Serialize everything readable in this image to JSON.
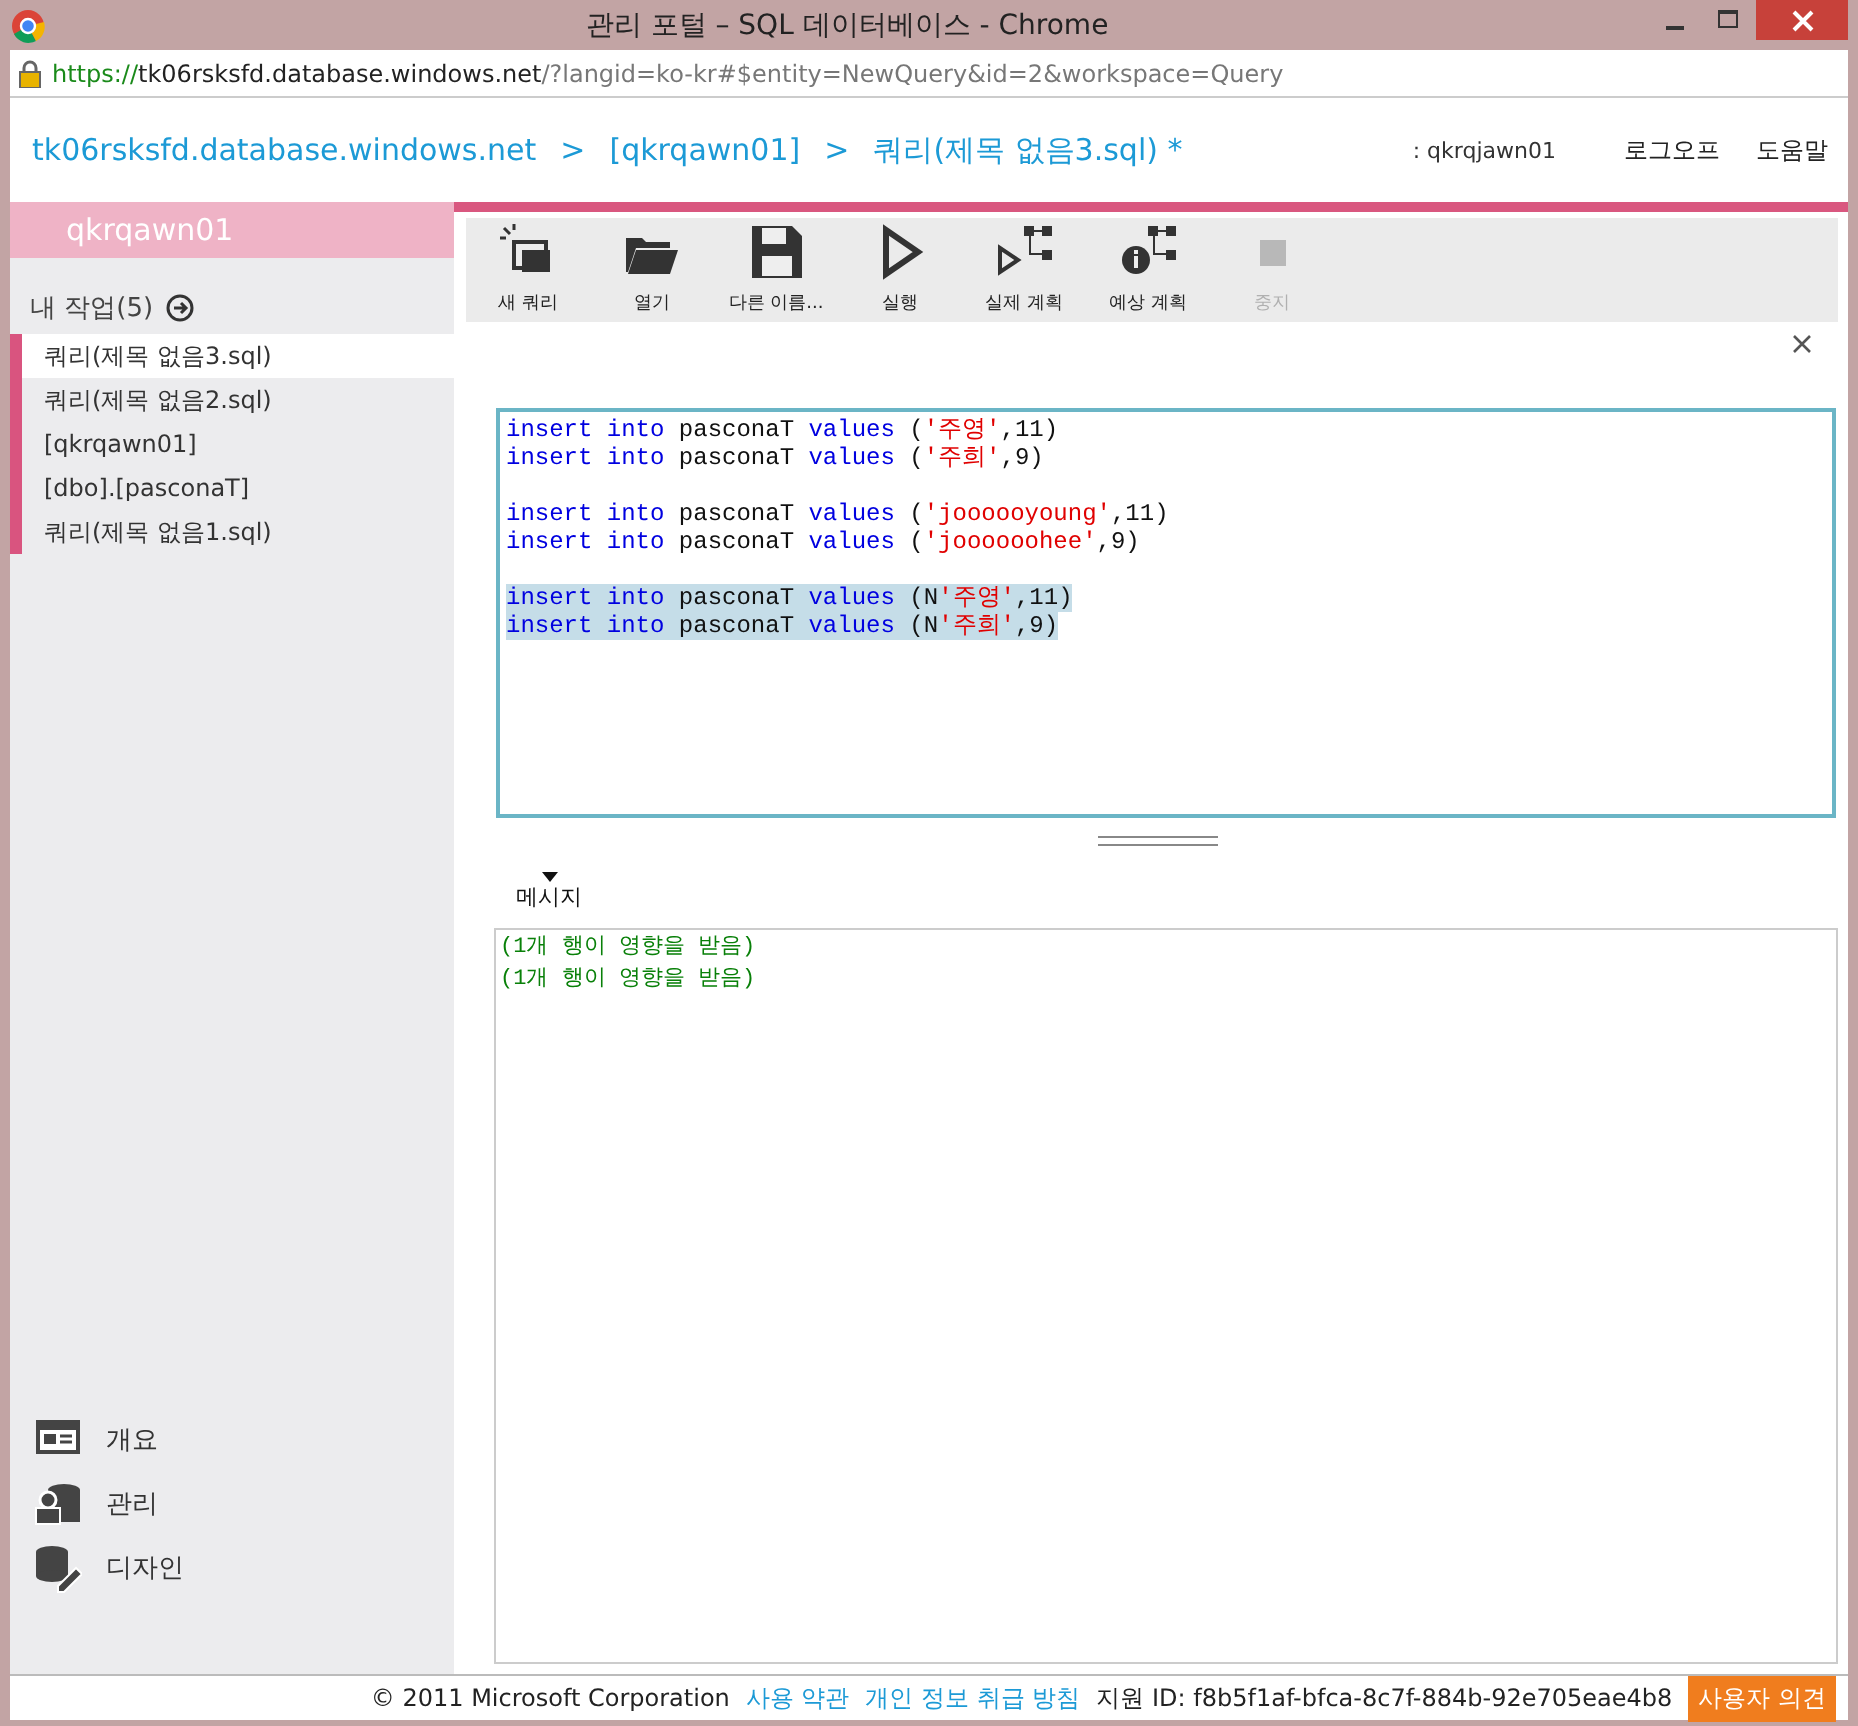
{
  "window": {
    "title": "관리 포털 – SQL 데이터베이스 - Chrome"
  },
  "address_bar": {
    "scheme": "https://",
    "host": "tk06rsksfd.database.windows.net",
    "path": "/?langid=ko-kr#$entity=NewQuery&id=2&workspace=Query"
  },
  "breadcrumb": [
    {
      "kind": "link",
      "text": "tk06rsksfd.database.windows.net"
    },
    {
      "kind": "separator",
      "text": ">"
    },
    {
      "kind": "link",
      "text": "[qkrqawn01]"
    },
    {
      "kind": "separator",
      "text": ">"
    },
    {
      "kind": "link",
      "text": "쿼리(제목 없음3.sql) *"
    }
  ],
  "user": {
    "label": ": qkrqjawn01"
  },
  "header_links": [
    {
      "label": "로그오프"
    },
    {
      "label": "도움말"
    }
  ],
  "sidebar": {
    "account": "qkrqawn01",
    "section": {
      "label": "내 작업(5)"
    },
    "items": [
      {
        "label": "쿼리(제목 없음3.sql)",
        "selected": true
      },
      {
        "label": "쿼리(제목 없음2.sql)",
        "selected": false
      },
      {
        "label": "[qkrqawn01]",
        "selected": false
      },
      {
        "label": "[dbo].[pasconaT]",
        "selected": false
      },
      {
        "label": "쿼리(제목 없음1.sql)",
        "selected": false
      }
    ],
    "nav": [
      {
        "kind": "overview",
        "label": "개요"
      },
      {
        "kind": "manage",
        "label": "관리"
      },
      {
        "kind": "design",
        "label": "디자인"
      }
    ]
  },
  "toolbar": {
    "buttons": [
      {
        "kind": "new",
        "label": "새 쿼리",
        "disabled": false
      },
      {
        "kind": "open",
        "label": "열기",
        "disabled": false
      },
      {
        "kind": "save",
        "label": "다른 이름...",
        "disabled": false
      },
      {
        "kind": "run",
        "label": "실행",
        "disabled": false
      },
      {
        "kind": "actual-plan",
        "label": "실제 계획",
        "disabled": false
      },
      {
        "kind": "estimated-plan",
        "label": "예상 계획",
        "disabled": false
      },
      {
        "kind": "stop",
        "label": "중지",
        "disabled": true
      }
    ]
  },
  "editor": {
    "lines": [
      {
        "kind": "code",
        "selected": false,
        "tokens": [
          {
            "kind": "keyword",
            "text": "insert into "
          },
          {
            "kind": "plain",
            "text": "pasconaT "
          },
          {
            "kind": "keyword",
            "text": "values "
          },
          {
            "kind": "plain",
            "text": "("
          },
          {
            "kind": "string",
            "text": "'주영'"
          },
          {
            "kind": "plain",
            "text": ",11)"
          }
        ]
      },
      {
        "kind": "code",
        "selected": false,
        "tokens": [
          {
            "kind": "keyword",
            "text": "insert into "
          },
          {
            "kind": "plain",
            "text": "pasconaT "
          },
          {
            "kind": "keyword",
            "text": "values "
          },
          {
            "kind": "plain",
            "text": "("
          },
          {
            "kind": "string",
            "text": "'주희'"
          },
          {
            "kind": "plain",
            "text": ",9)"
          }
        ]
      },
      {
        "kind": "blank"
      },
      {
        "kind": "code",
        "selected": false,
        "tokens": [
          {
            "kind": "keyword",
            "text": "insert into "
          },
          {
            "kind": "plain",
            "text": "pasconaT "
          },
          {
            "kind": "keyword",
            "text": "values "
          },
          {
            "kind": "plain",
            "text": "("
          },
          {
            "kind": "string",
            "text": "'joooooyoung'"
          },
          {
            "kind": "plain",
            "text": ",11)"
          }
        ]
      },
      {
        "kind": "code",
        "selected": false,
        "tokens": [
          {
            "kind": "keyword",
            "text": "insert into "
          },
          {
            "kind": "plain",
            "text": "pasconaT "
          },
          {
            "kind": "keyword",
            "text": "values "
          },
          {
            "kind": "plain",
            "text": "("
          },
          {
            "kind": "string",
            "text": "'joooooohee'"
          },
          {
            "kind": "plain",
            "text": ",9)"
          }
        ]
      },
      {
        "kind": "blank"
      },
      {
        "kind": "code",
        "selected": true,
        "tokens": [
          {
            "kind": "keyword",
            "text": "insert into "
          },
          {
            "kind": "plain",
            "text": "pasconaT "
          },
          {
            "kind": "keyword",
            "text": "values "
          },
          {
            "kind": "plain",
            "text": "(N"
          },
          {
            "kind": "string",
            "text": "'주영'"
          },
          {
            "kind": "plain",
            "text": ",11)"
          }
        ]
      },
      {
        "kind": "code",
        "selected": true,
        "tokens": [
          {
            "kind": "keyword",
            "text": "insert into "
          },
          {
            "kind": "plain",
            "text": "pasconaT "
          },
          {
            "kind": "keyword",
            "text": "values "
          },
          {
            "kind": "plain",
            "text": "(N"
          },
          {
            "kind": "string",
            "text": "'주희'"
          },
          {
            "kind": "plain",
            "text": ",9)"
          }
        ]
      }
    ]
  },
  "results": {
    "tab": "메시지",
    "messages": [
      "(1개 행이 영향을 받음)",
      "(1개 행이 영향을 받음)"
    ]
  },
  "footer": {
    "copyright": "© 2011 Microsoft Corporation",
    "links": [
      "사용 약관",
      "개인 정보 취급 방침"
    ],
    "support_label": "지원 ID:",
    "support_id": "f8b5f1af-bfca-8c7f-884b-92e705eae4b8",
    "feedback": "사용자 의견"
  }
}
